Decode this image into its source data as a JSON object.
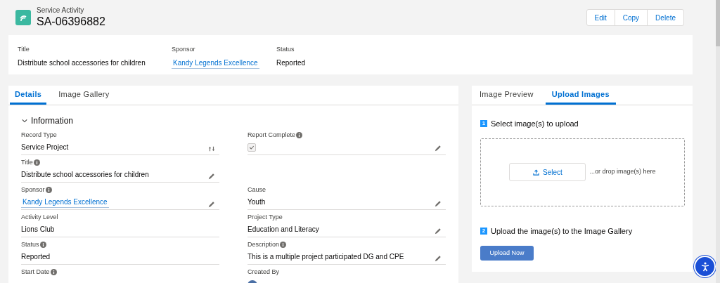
{
  "header": {
    "object_type": "Service Activity",
    "record_name": "SA-06396882",
    "actions": [
      "Edit",
      "Copy",
      "Delete"
    ]
  },
  "highlights": [
    {
      "label": "Title",
      "value": "Distribute school accessories for children",
      "kind": "text"
    },
    {
      "label": "Sponsor",
      "value": "Kandy Legends Excellence",
      "kind": "link"
    },
    {
      "label": "Status",
      "value": "Reported",
      "kind": "text"
    }
  ],
  "details": {
    "tabs": [
      {
        "label": "Details",
        "selected": true
      },
      {
        "label": "Image Gallery",
        "selected": false
      }
    ],
    "section": {
      "title": "Information",
      "expanded": true
    },
    "rows": [
      {
        "left": {
          "label": "Record Type",
          "info": false,
          "value": "Service Project",
          "kind": "record_type",
          "editable": true
        },
        "right": {
          "label": "Report Complete",
          "info": true,
          "kind": "checkbox",
          "checked": true,
          "editable": true
        }
      },
      {
        "left": {
          "label": "Title",
          "info": true,
          "value": "Distribute school accessories for children",
          "kind": "text",
          "editable": true
        }
      },
      {
        "left": {
          "label": "Sponsor",
          "info": true,
          "value": "Kandy Legends Excellence",
          "kind": "link",
          "editable": true
        },
        "right": {
          "label": "Cause",
          "info": false,
          "value": "Youth",
          "kind": "text",
          "editable": true
        }
      },
      {
        "left": {
          "label": "Activity Level",
          "info": false,
          "value": "Lions Club",
          "kind": "text",
          "editable": false
        },
        "right": {
          "label": "Project Type",
          "info": false,
          "value": "Education and Literacy",
          "kind": "text",
          "editable": true
        }
      },
      {
        "left": {
          "label": "Status",
          "info": true,
          "value": "Reported",
          "kind": "text",
          "editable": false
        },
        "right": {
          "label": "Description",
          "info": true,
          "value": "This is a multiple project participated DG and CPE",
          "kind": "text",
          "editable": true
        }
      },
      {
        "left": {
          "label": "Start Date",
          "info": true,
          "kind": "empty"
        },
        "right": {
          "label": "Created By",
          "info": false,
          "kind": "user"
        }
      }
    ]
  },
  "uploader": {
    "tabs": [
      {
        "label": "Image Preview",
        "selected": false
      },
      {
        "label": "Upload Images",
        "selected": true
      }
    ],
    "step1": {
      "number": "1",
      "title": "Select image(s) to upload"
    },
    "select_button": "Select",
    "drop_hint": "...or drop image(s) here",
    "step2": {
      "number": "2",
      "title": "Upload the image(s) to the Image Gallery"
    },
    "upload_button": "Upload Now"
  }
}
